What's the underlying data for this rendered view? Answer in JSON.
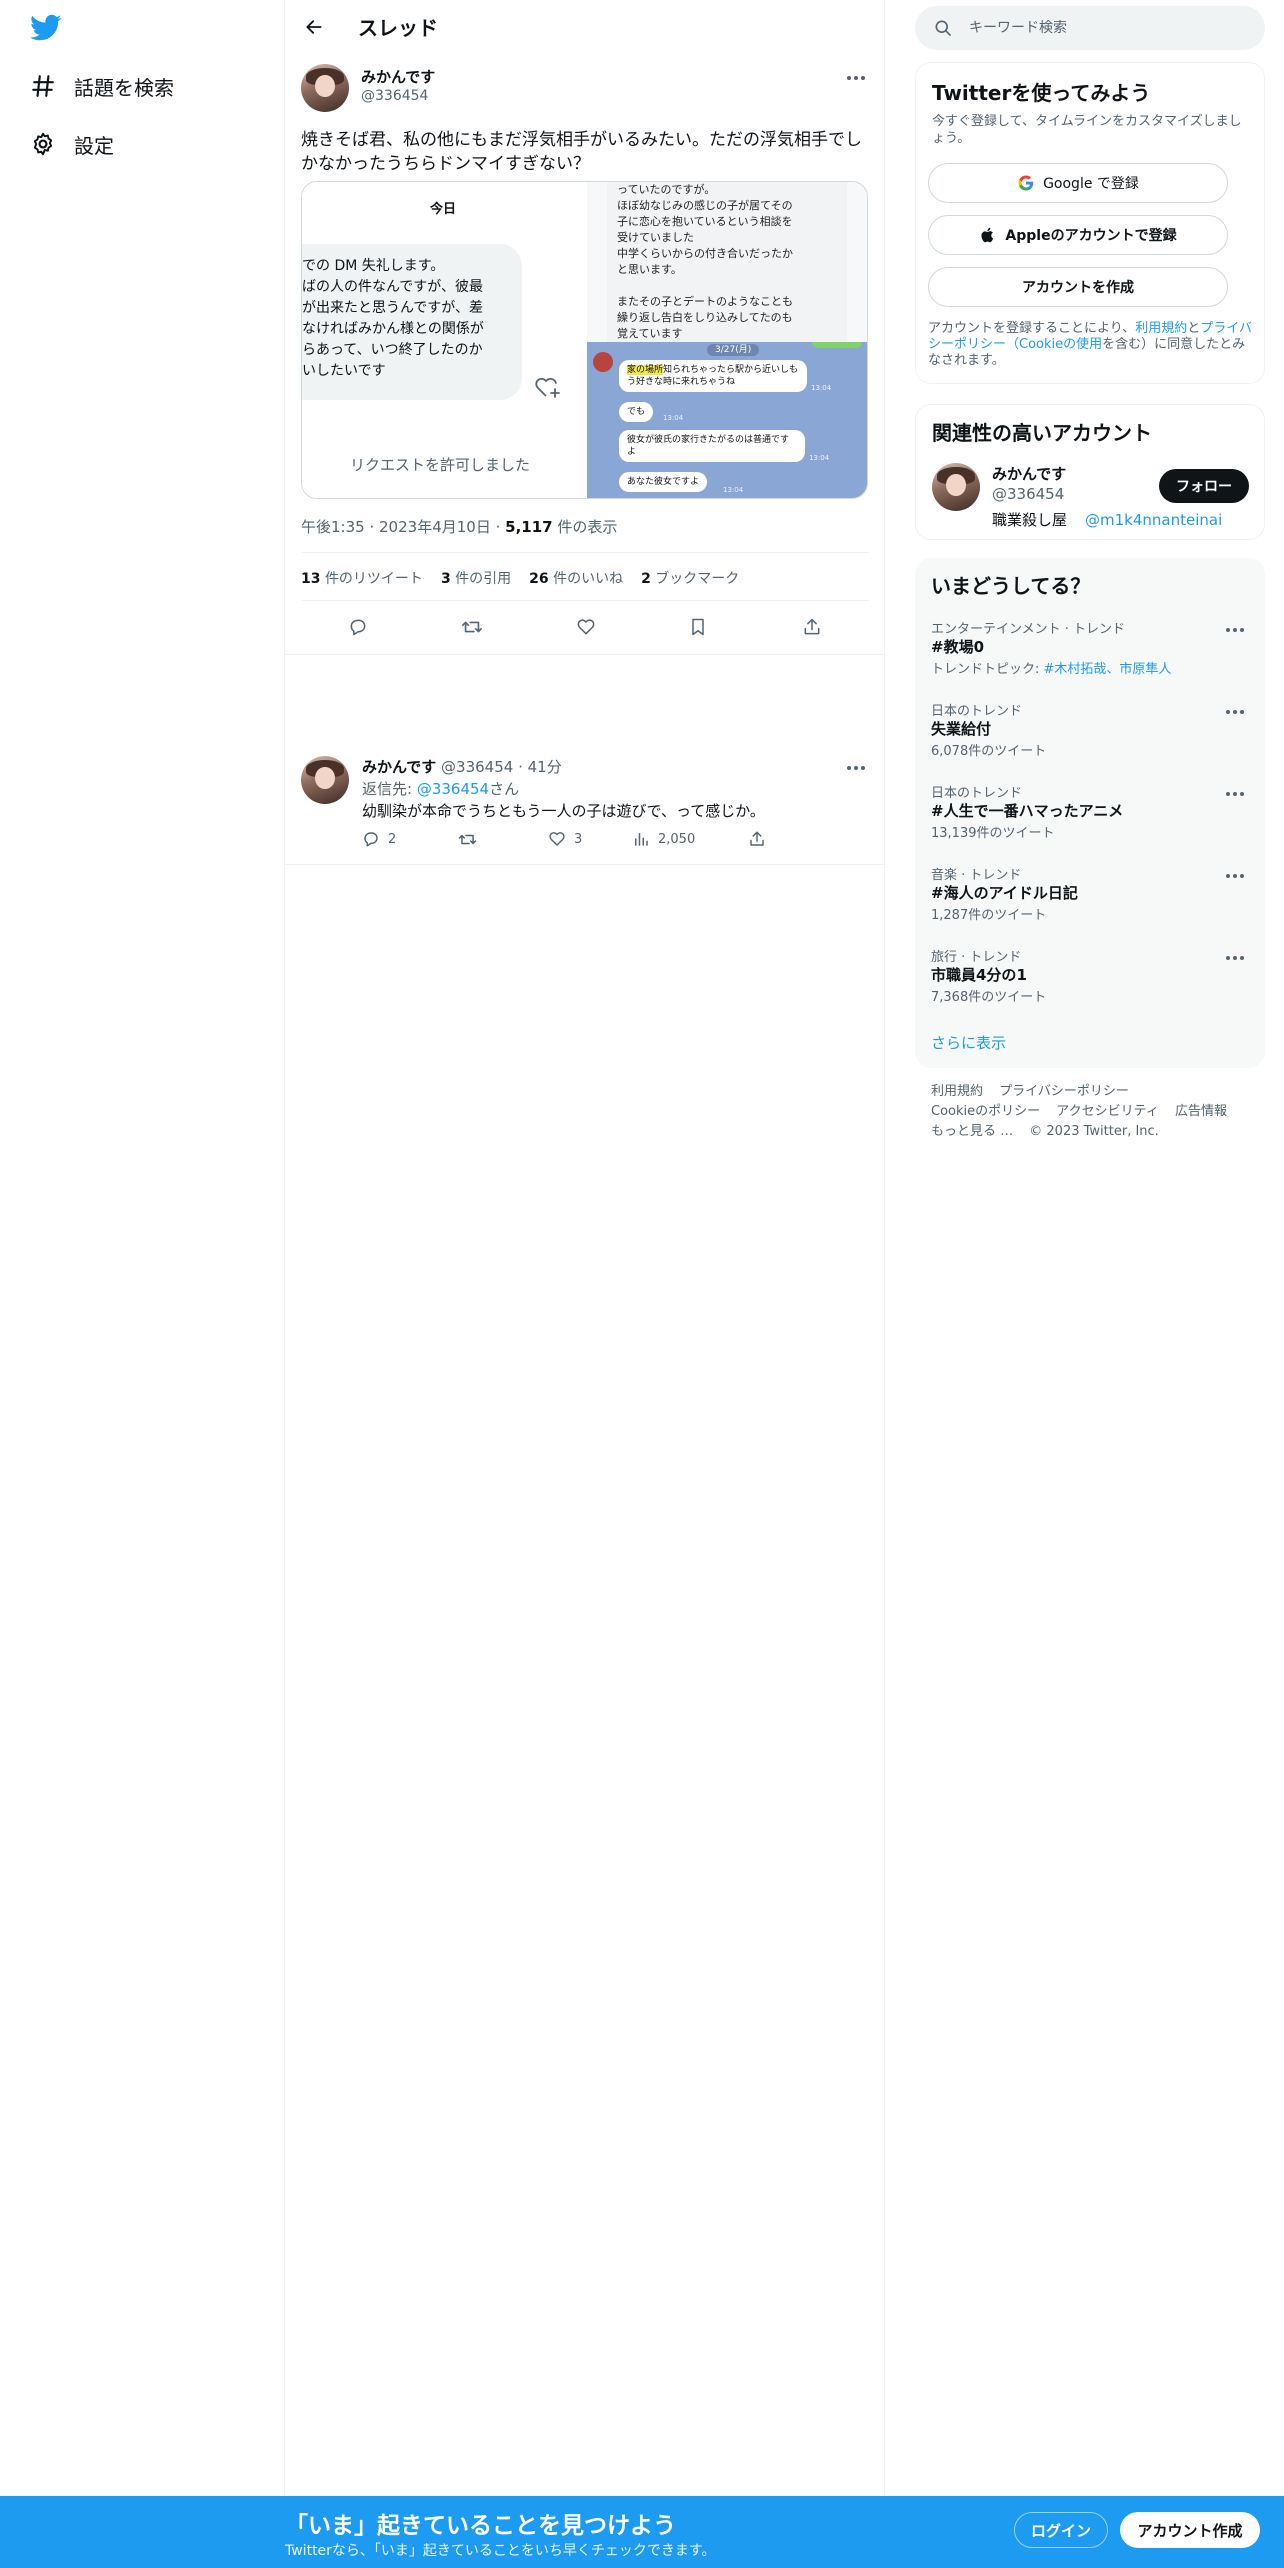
{
  "nav": {
    "explore_label": "話題を検索",
    "settings_label": "設定"
  },
  "header": {
    "title": "スレッド"
  },
  "tweet": {
    "author_name": "みかんです",
    "author_handle": "@336454",
    "text": "焼きそば君、私の他にもまだ浮気相手がいるみたい。ただの浮気相手でしかなかったうちらドンマイすぎない？",
    "media": {
      "dm_today": "今日",
      "dm_lines": [
        "での DM 失礼します。",
        "ばの人の件なんですが、彼最",
        "が出来たと思うんですが、差",
        "なければみかん様との関係が",
        "らあって、いつ終了したのか",
        "いしたいです"
      ],
      "dm_allowed": "リクエストを許可しました",
      "right_lines": [
        "っていたのですが。",
        "ほぼ幼なじみの感じの子が居てその",
        "子に恋心を抱いているという相談を",
        "受けていました",
        "中学くらいからの付き合いだったか",
        "と思います。",
        "",
        "またその子とデートのようなことも",
        "繰り返し告白をしり込みしてたのも",
        "覚えています"
      ],
      "line_date": "3/27(月)",
      "line_msgs": [
        {
          "prefix": "家の場所",
          "text": "知られちゃったら駅から近いしもう好きな時に来れちゃうね",
          "time": "13:04"
        },
        {
          "prefix": "",
          "text": "でも",
          "time": "13:04"
        },
        {
          "prefix": "",
          "text": "彼女が彼氏の家行きたがるのは普通ですよ",
          "time": "13:04"
        },
        {
          "prefix": "",
          "text": "あなた彼女ですよ",
          "time": "13:04"
        }
      ]
    },
    "time": "午後1:35",
    "date": "2023年4月10日",
    "views_count": "5,117",
    "views_label": "件の表示",
    "stats": {
      "retweets_count": "13",
      "retweets_label": "件のリツイート",
      "quotes_count": "3",
      "quotes_label": "件の引用",
      "likes_count": "26",
      "likes_label": "件のいいね",
      "bookmarks_count": "2",
      "bookmarks_label": "ブックマーク"
    }
  },
  "reply": {
    "author_name": "みかんです",
    "meta": "@336454 · 41分",
    "reply_prefix": "返信先: ",
    "reply_to": "@336454",
    "reply_suffix": "さん",
    "text": "幼馴染が本命でうちともう一人の子は遊びで、って感じか。",
    "replies": "2",
    "likes": "3",
    "views": "2,050"
  },
  "search": {
    "placeholder": "キーワード検索"
  },
  "signup_panel": {
    "title": "Twitterを使ってみよう",
    "subtitle": "今すぐ登録して、タイムラインをカスタマイズしましょう。",
    "google_label": "Google で登録",
    "apple_label": "Appleのアカウントで登録",
    "create_label": "アカウントを作成",
    "legal_pre": "アカウントを登録することにより、",
    "legal_terms": "利用規約",
    "legal_and": "と",
    "legal_privacy": "プライバシーポリシー（Cookieの使用",
    "legal_post": "を含む）に同意したとみなされます。"
  },
  "related": {
    "title": "関連性の高いアカウント",
    "name": "みかんです",
    "handle": "@336454",
    "bio": "職業殺し屋",
    "bio_link": "@m1k4nnanteinai",
    "follow_label": "フォロー"
  },
  "trends": {
    "title": "いまどうしてる？",
    "items": [
      {
        "category": "エンターテインメント · トレンド",
        "name": "#教場0",
        "count_prefix": "トレンドトピック: ",
        "count": "#木村拓哉、市原隼人"
      },
      {
        "category": "日本のトレンド",
        "name": "失業給付",
        "count_prefix": "",
        "count": "6,078件のツイート"
      },
      {
        "category": "日本のトレンド",
        "name": "#人生で一番ハマったアニメ",
        "count_prefix": "",
        "count": "13,139件のツイート"
      },
      {
        "category": "音楽 · トレンド",
        "name": "#海人のアイドル日記",
        "count_prefix": "",
        "count": "1,287件のツイート"
      },
      {
        "category": "旅行 · トレンド",
        "name": "市職員4分の1",
        "count_prefix": "",
        "count": "7,368件のツイート"
      }
    ],
    "show_more": "さらに表示"
  },
  "footer": {
    "links": [
      "利用規約",
      "プライバシーポリシー",
      "Cookieのポリシー",
      "アクセシビリティ",
      "広告情報",
      "もっと見る …",
      "© 2023 Twitter, Inc."
    ]
  },
  "banner": {
    "headline": "「いま」起きていることを見つけよう",
    "sub": "Twitterなら、「いま」起きていることをいち早くチェックできます。",
    "login_label": "ログイン",
    "signup_label": "アカウント作成"
  },
  "colors": {
    "accent": "#1d9bf0",
    "text": "#0f1419",
    "muted": "#536471"
  }
}
